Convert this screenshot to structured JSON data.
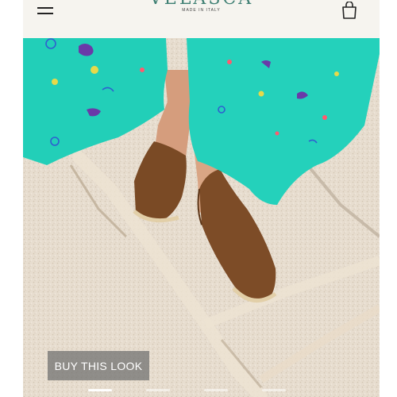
{
  "header": {
    "brand_name": "VELASCA",
    "brand_tagline": "MADE IN ITALY",
    "menu_icon": "hamburger-menu-icon",
    "bag_icon": "shopping-bag-icon"
  },
  "hero": {
    "image_icon": "product-lifestyle-photo",
    "cta_label": "BUY THIS LOOK"
  },
  "carousel": {
    "slides": 4,
    "active_index": 0
  },
  "colors": {
    "brand": "#3e7f73",
    "dress": "#22cfb8",
    "shoe": "#7a4a25",
    "ground": "#e6dccd",
    "cta_bg": "#6e6e6e"
  }
}
